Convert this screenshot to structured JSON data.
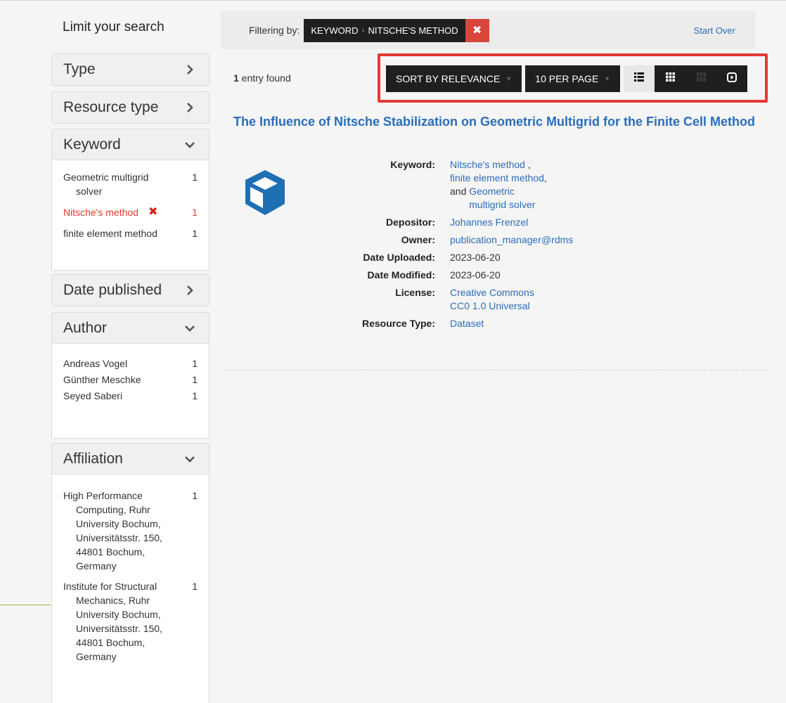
{
  "sidebar": {
    "title": "Limit your search",
    "facets": {
      "type": {
        "label": "Type"
      },
      "resource_type": {
        "label": "Resource type"
      },
      "keyword": {
        "label": "Keyword",
        "items": [
          {
            "label": "Geometric multigrid solver",
            "count": "1"
          },
          {
            "label": "Nitsche's method",
            "count": "1",
            "selected": true
          },
          {
            "label": "finite element method",
            "count": "1"
          }
        ]
      },
      "date_published": {
        "label": "Date published"
      },
      "author": {
        "label": "Author",
        "items": [
          {
            "label": "Andreas Vogel",
            "count": "1"
          },
          {
            "label": "Günther Meschke",
            "count": "1"
          },
          {
            "label": "Seyed Saberi",
            "count": "1"
          }
        ]
      },
      "affiliation": {
        "label": "Affiliation",
        "items": [
          {
            "label": "High Performance Computing, Ruhr University Bochum, Universitätsstr. 150, 44801 Bochum, Germany",
            "count": "1"
          },
          {
            "label": "Institute for Structural Mechanics, Ruhr University Bochum, Universitätsstr. 150, 44801 Bochum, Germany",
            "count": "1"
          }
        ]
      }
    }
  },
  "filter": {
    "label": "Filtering by:",
    "field": "Keyword",
    "value": "Nitsche's method",
    "start_over": "Start Over"
  },
  "results": {
    "count": "1",
    "count_suffix": " entry found",
    "sort_label": "Sort by relevance",
    "per_page_label": "10 per page",
    "view_icons": [
      "list-view-icon",
      "gallery-view-icon",
      "masonry-view-icon",
      "slideshow-view-icon"
    ]
  },
  "record": {
    "title": "The Influence of Nitsche Stabilization on Geometric Multigrid for the Finite Cell Method",
    "icon": "cube-icon",
    "keyword_label": "Keyword:",
    "keywords": [
      "Nitsche's method",
      "finite element method",
      "Geometric multigrid solver"
    ],
    "keyword_joiner_and": "and",
    "depositor_label": "Depositor:",
    "depositor": "Johannes Frenzel",
    "owner_label": "Owner:",
    "owner": "publication_manager@rdms",
    "uploaded_label": "Date Uploaded:",
    "uploaded": "2023-06-20",
    "modified_label": "Date Modified:",
    "modified": "2023-06-20",
    "license_label": "License:",
    "license_line1": "Creative Commons",
    "license_line2": "CC0 1.0 Universal",
    "resource_type_label": "Resource Type:",
    "resource_type": "Dataset"
  },
  "colors": {
    "link": "#2a6db8",
    "selected_facet": "#e23c2f",
    "highlight": "#e53935",
    "remove_button": "#d9463a"
  }
}
